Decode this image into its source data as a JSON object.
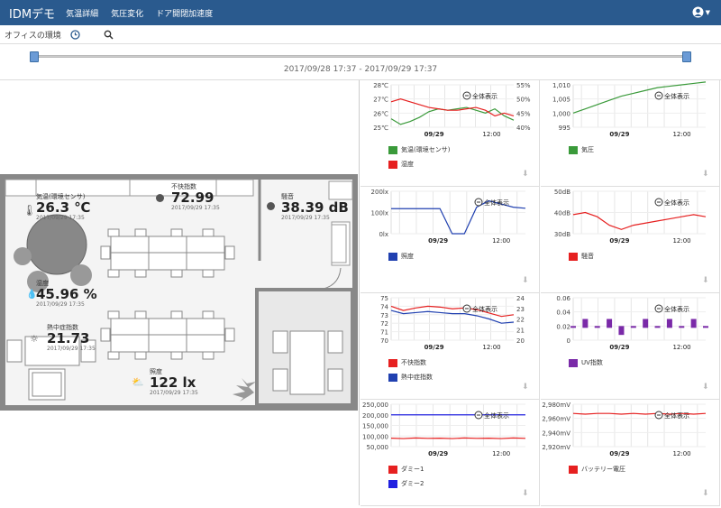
{
  "app": {
    "brand": "IDMデモ",
    "nav": [
      "気温詳細",
      "気圧変化",
      "ドア開閉加速度"
    ]
  },
  "subbar": {
    "title": "オフィスの環境"
  },
  "range": {
    "label": "2017/09/28 17:37 - 2017/09/29 17:37"
  },
  "zoom_label": "全体表示",
  "readings": [
    {
      "label": "気温(環境センサ)",
      "value": "26.3 ℃",
      "time": "2017/09/29 17:35"
    },
    {
      "label": "不快指数",
      "value": "72.99",
      "time": "2017/09/29 17:35"
    },
    {
      "label": "騒音",
      "value": "38.39 dB",
      "time": "2017/09/29 17:35"
    },
    {
      "label": "湿度",
      "value": "45.96 %",
      "time": "2017/09/29 17:35"
    },
    {
      "label": "熱中症指数",
      "value": "21.73",
      "time": "2017/09/29 17:35"
    },
    {
      "label": "照度",
      "value": "122 lx",
      "time": "2017/09/29 17:35"
    }
  ],
  "colors": {
    "navbar": "#2a5a8e",
    "green": "#3a9a3a",
    "red": "#e62020",
    "blue": "#2040b0",
    "purple": "#7a2aa8"
  },
  "chart_data": [
    {
      "type": "line",
      "x_ticks": [
        "09/29",
        "12:00"
      ],
      "left_ticks": [
        "28℃",
        "27℃",
        "26℃",
        "25℃"
      ],
      "right_ticks": [
        "55%",
        "50%",
        "45%",
        "40%"
      ],
      "series": [
        {
          "name": "気温(環境センサ)",
          "color": "#3a9a3a",
          "values": [
            25.6,
            25.2,
            25.4,
            25.7,
            26.1,
            26.3,
            26.2,
            26.3,
            26.4,
            26.2,
            26.0,
            26.3,
            25.8,
            25.5
          ]
        },
        {
          "name": "湿度",
          "color": "#e62020",
          "values": [
            49,
            50,
            49,
            48,
            47,
            46.5,
            46,
            46,
            46.5,
            47,
            46,
            44,
            45,
            44
          ]
        }
      ]
    },
    {
      "type": "line",
      "x_ticks": [
        "09/29",
        "12:00"
      ],
      "left_ticks": [
        "1,010",
        "1,005",
        "1,000",
        "995"
      ],
      "series": [
        {
          "name": "気圧",
          "color": "#3a9a3a",
          "values": [
            1000,
            1001.5,
            1003,
            1004.5,
            1006,
            1007,
            1008,
            1009,
            1009.5,
            1010,
            1010.5,
            1011
          ]
        }
      ]
    },
    {
      "type": "line",
      "x_ticks": [
        "09/29",
        "12:00"
      ],
      "left_ticks": [
        "200lx",
        "100lx",
        "0lx"
      ],
      "series": [
        {
          "name": "照度",
          "color": "#2040b0",
          "values": [
            118,
            118,
            118,
            118,
            118,
            0,
            0,
            125,
            155,
            140,
            125,
            120
          ]
        }
      ]
    },
    {
      "type": "line",
      "x_ticks": [
        "09/29",
        "12:00"
      ],
      "left_ticks": [
        "50dB",
        "40dB",
        "30dB"
      ],
      "series": [
        {
          "name": "騒音",
          "color": "#e62020",
          "values": [
            39,
            40,
            38,
            34,
            32,
            34,
            35,
            36,
            37,
            38,
            39,
            38
          ]
        }
      ]
    },
    {
      "type": "line",
      "x_ticks": [
        "09/29",
        "12:00"
      ],
      "left_ticks": [
        "75",
        "74",
        "73",
        "72",
        "71",
        "70"
      ],
      "right_ticks": [
        "24",
        "23",
        "22",
        "21",
        "20"
      ],
      "series": [
        {
          "name": "不快指数",
          "color": "#e62020",
          "values": [
            74,
            73.5,
            73.8,
            74,
            73.9,
            73.7,
            73.8,
            73.6,
            73.2,
            72.8,
            73
          ]
        },
        {
          "name": "熱中症指数",
          "color": "#2040b0",
          "values": [
            22.8,
            22.5,
            22.6,
            22.7,
            22.6,
            22.5,
            22.5,
            22.3,
            22,
            21.6,
            21.7
          ]
        }
      ]
    },
    {
      "type": "bar",
      "x_ticks": [
        "09/29",
        "12:00"
      ],
      "left_ticks": [
        "0.06",
        "0.04",
        "0.02",
        "0"
      ],
      "series": [
        {
          "name": "UV指数",
          "color": "#7a2aa8",
          "values": [
            0.02,
            0.03,
            0.02,
            0.03,
            0.01,
            0.02,
            0.03,
            0.02,
            0.03,
            0.02,
            0.03,
            0.02
          ]
        }
      ]
    },
    {
      "type": "line",
      "x_ticks": [
        "09/29",
        "12:00"
      ],
      "left_ticks": [
        "250,000",
        "200,000",
        "150,000",
        "100,000",
        "50,000"
      ],
      "series": [
        {
          "name": "ダミー1",
          "color": "#e62020",
          "values": [
            90000,
            88000,
            91000,
            89000,
            90000,
            88000,
            91000,
            89000,
            90000,
            88000,
            91000,
            89000
          ]
        },
        {
          "name": "ダミー2",
          "color": "#2020e0",
          "values": [
            200000,
            200000,
            200000,
            200000,
            200000,
            200000,
            200000,
            200000,
            200000,
            200000,
            200000,
            200000
          ]
        }
      ]
    },
    {
      "type": "line",
      "x_ticks": [
        "09/29",
        "12:00"
      ],
      "left_ticks": [
        "2,980mV",
        "2,960mV",
        "2,940mV",
        "2,920mV"
      ],
      "series": [
        {
          "name": "バッテリー電圧",
          "color": "#e62020",
          "values": [
            2967,
            2966,
            2967,
            2967,
            2966,
            2967,
            2966,
            2967,
            2966,
            2967,
            2966,
            2967
          ]
        }
      ]
    }
  ]
}
